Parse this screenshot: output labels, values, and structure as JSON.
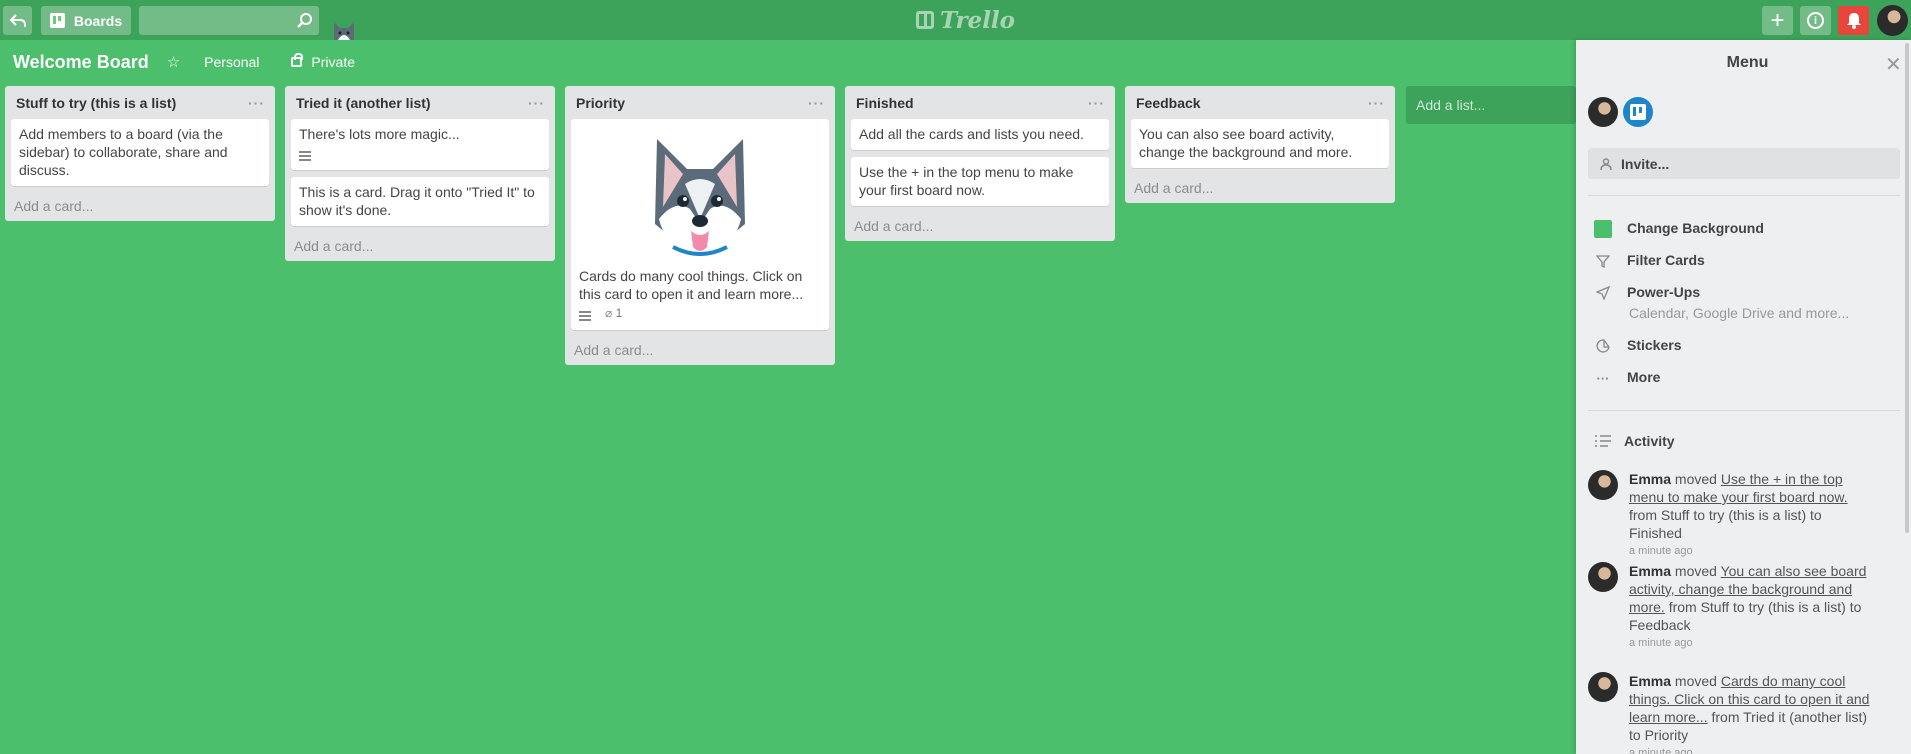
{
  "app": {
    "logo_text": "Trello",
    "accent": "#4bbf6b",
    "header_color": "#3da25a",
    "notification_color": "#e8453c"
  },
  "header": {
    "back_icon": "back-arrow-icon",
    "boards_label": "Boards",
    "search_value": "",
    "add_label": "+"
  },
  "board": {
    "title": "Welcome Board",
    "team_label": "Personal",
    "visibility_label": "Private"
  },
  "lists": [
    {
      "title": "Stuff to try (this is a list)",
      "cards": [
        "Add members to a board (via the sidebar) to collaborate, share and discuss."
      ],
      "add_card": "Add a card..."
    },
    {
      "title": "Tried it (another list)",
      "cards": [
        "There's lots more magic...",
        "This is a card. Drag it onto \"Tried It\" to show it's done."
      ],
      "add_card": "Add a card..."
    },
    {
      "title": "Priority",
      "cards": [
        "Cards do many cool things. Click on this card to open it and learn more..."
      ],
      "attachments": "1",
      "add_card": "Add a card..."
    },
    {
      "title": "Finished",
      "cards": [
        "Add all the cards and lists you need.",
        "Use the + in the top menu to make your first board now."
      ],
      "add_card": "Add a card..."
    },
    {
      "title": "Feedback",
      "cards": [
        "You can also see board activity, change the background and more."
      ],
      "add_card": "Add a card..."
    }
  ],
  "add_list_label": "Add a list...",
  "menu": {
    "title": "Menu",
    "invite_label": "Invite...",
    "items": [
      {
        "label": "Change Background"
      },
      {
        "label": "Filter Cards"
      },
      {
        "label": "Power-Ups",
        "sub": "Calendar, Google Drive and more..."
      },
      {
        "label": "Stickers"
      },
      {
        "label": "More"
      }
    ],
    "activity_title": "Activity",
    "activity": [
      {
        "user": "Emma",
        "verb": "moved",
        "card": "Use the + in the top menu to make your first board now.",
        "rest": "from Stuff to try (this is a list) to Finished",
        "time": "a minute ago"
      },
      {
        "user": "Emma",
        "verb": "moved",
        "card": "You can also see board activity, change the background and more.",
        "rest": "from Stuff to try (this is a list) to Feedback",
        "time": "a minute ago"
      },
      {
        "user": "Emma",
        "verb": "moved",
        "card": "Cards do many cool things. Click on this card to open it and learn more...",
        "rest": "from Tried it (another list) to Priority",
        "time": "a minute ago"
      }
    ]
  }
}
